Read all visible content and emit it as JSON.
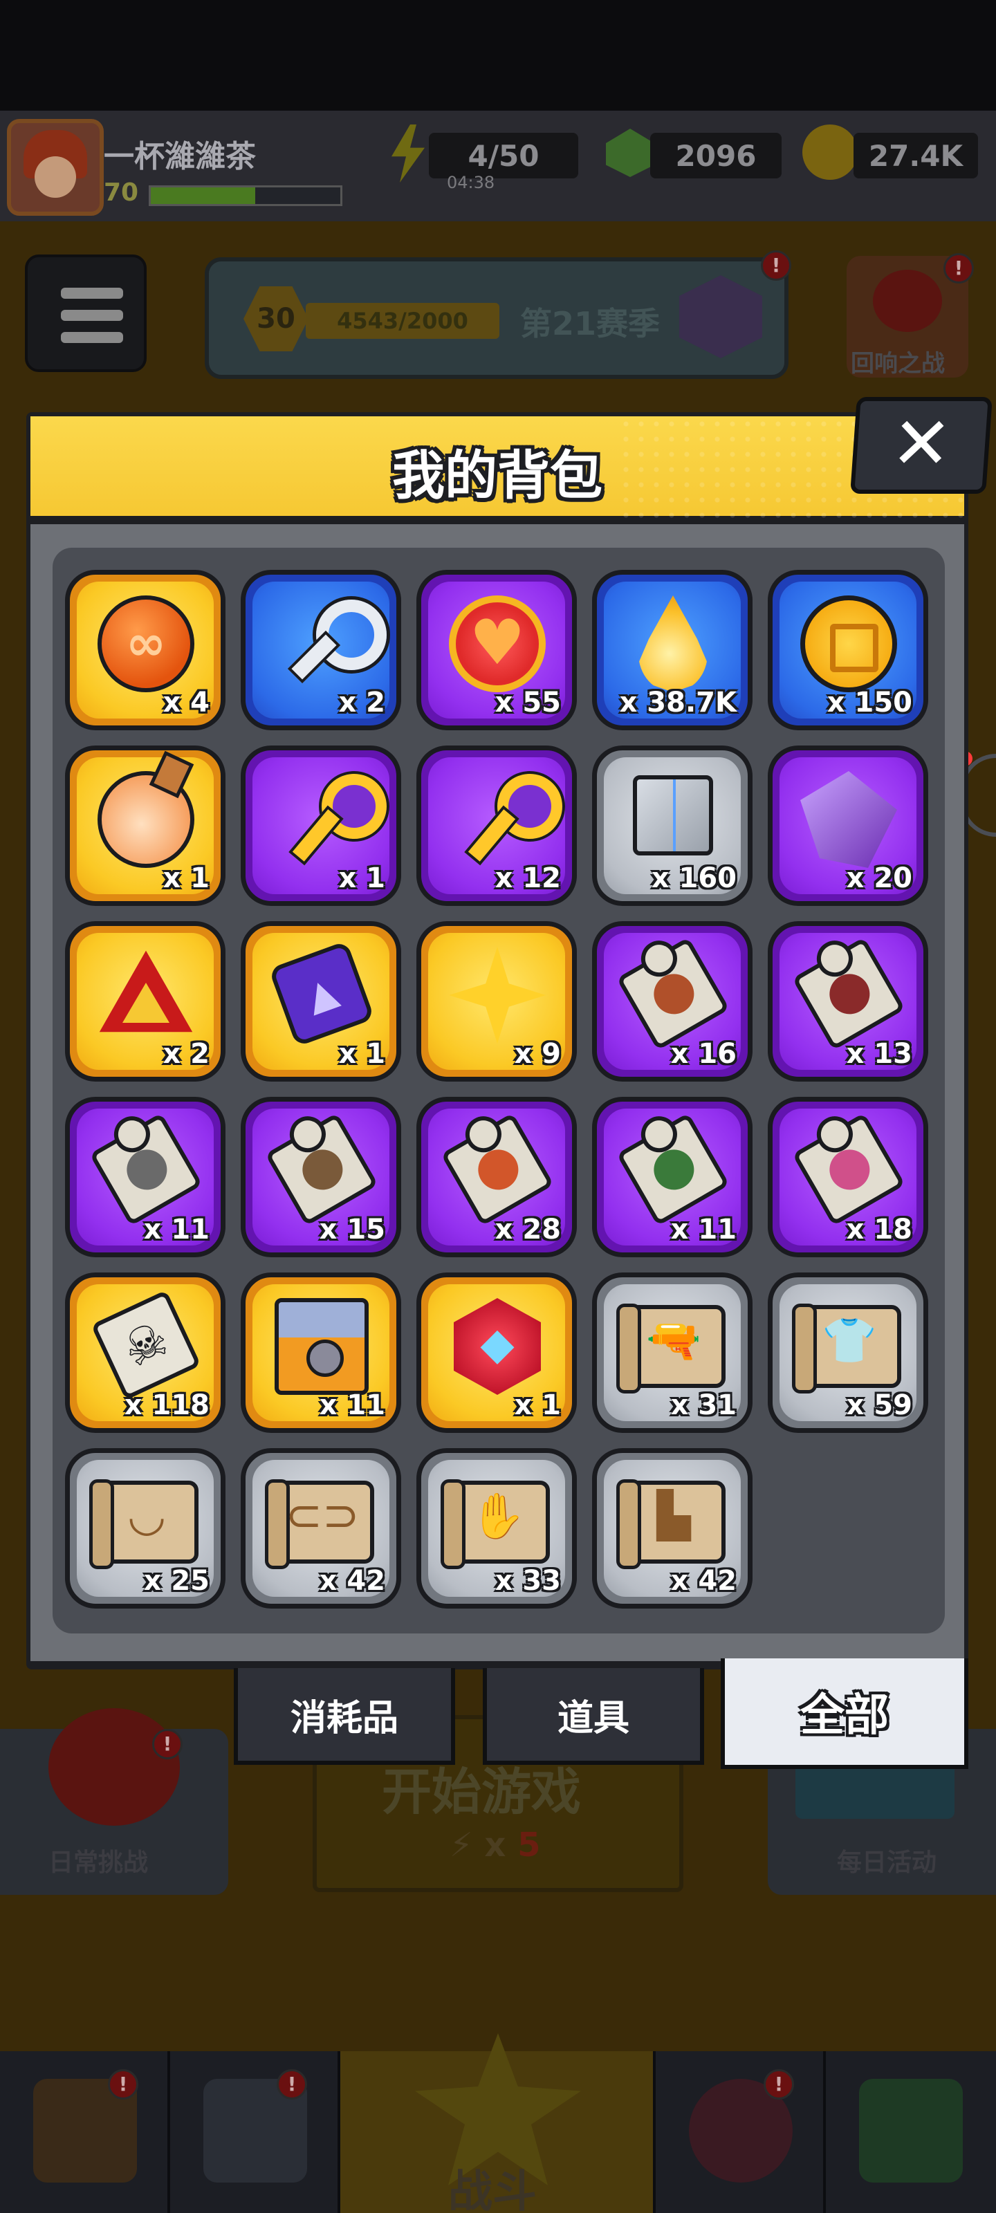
{
  "header": {
    "player_name": "一杯濰濰茶",
    "player_level": "70",
    "xp_fill": 0.55,
    "energy": "4/50",
    "energy_timer": "04:38",
    "gems": "2096",
    "coins": "27.4K"
  },
  "season": {
    "level": "30",
    "progress_text": "4543/2000",
    "season_label": "第21赛季"
  },
  "side_buttons": {
    "echo_battle": "回响之战",
    "daily_challenge": "日常挑战",
    "daily_activity": "每日活动"
  },
  "start_game": {
    "label": "开始游戏",
    "cost_prefix": "x",
    "cost": "5"
  },
  "bottom_nav": {
    "battle": "战斗"
  },
  "modal": {
    "title": "我的背包",
    "close_label": "✕",
    "tabs": [
      {
        "label": "消耗品"
      },
      {
        "label": "道具"
      },
      {
        "label": "全部",
        "active": true
      }
    ],
    "items": [
      {
        "name": "orb-item",
        "qty": "x 4",
        "rarity": "gold",
        "icon": "i-orb"
      },
      {
        "name": "silver-key-item",
        "qty": "x 2",
        "rarity": "blue",
        "icon": "i-key"
      },
      {
        "name": "heart-medal-item",
        "qty": "x 55",
        "rarity": "purple",
        "icon": "i-heart"
      },
      {
        "name": "gold-drop-item",
        "qty": "x 38.7K",
        "rarity": "blue",
        "icon": "i-drop"
      },
      {
        "name": "gold-coin-item",
        "qty": "x 150",
        "rarity": "blue",
        "icon": "i-coin"
      },
      {
        "name": "potion-item",
        "qty": "x 1",
        "rarity": "gold",
        "icon": "i-potion"
      },
      {
        "name": "gem-key-item",
        "qty": "x 1",
        "rarity": "purple",
        "icon": "i-gkey"
      },
      {
        "name": "hex-key-item",
        "qty": "x 12",
        "rarity": "purple",
        "icon": "i-gkey"
      },
      {
        "name": "metal-cube-item",
        "qty": "x 160",
        "rarity": "grey",
        "icon": "i-cube"
      },
      {
        "name": "crystal-item",
        "qty": "x 20",
        "rarity": "purple",
        "icon": "i-crystal"
      },
      {
        "name": "red-triangle-item",
        "qty": "x 2",
        "rarity": "gold",
        "icon": "i-triangle"
      },
      {
        "name": "chip-item",
        "qty": "x 1",
        "rarity": "gold",
        "icon": "i-chip"
      },
      {
        "name": "star-item",
        "qty": "x 9",
        "rarity": "gold",
        "icon": "i-star4"
      },
      {
        "name": "puzzle-item-1",
        "qty": "x 16",
        "rarity": "purple",
        "icon": "i-puzzle",
        "tint": "#b0502a"
      },
      {
        "name": "puzzle-item-2",
        "qty": "x 13",
        "rarity": "purple",
        "icon": "i-puzzle",
        "tint": "#8a2a2a"
      },
      {
        "name": "puzzle-item-3",
        "qty": "x 11",
        "rarity": "purple",
        "icon": "i-puzzle",
        "tint": "#6a6a6a"
      },
      {
        "name": "puzzle-item-4",
        "qty": "x 15",
        "rarity": "purple",
        "icon": "i-puzzle",
        "tint": "#7a5a3a"
      },
      {
        "name": "puzzle-item-5",
        "qty": "x 28",
        "rarity": "purple",
        "icon": "i-puzzle",
        "tint": "#d2562a"
      },
      {
        "name": "puzzle-item-6",
        "qty": "x 11",
        "rarity": "purple",
        "icon": "i-puzzle",
        "tint": "#3a7a3a"
      },
      {
        "name": "puzzle-item-7",
        "qty": "x 18",
        "rarity": "purple",
        "icon": "i-puzzle",
        "tint": "#d0508a"
      },
      {
        "name": "skull-puzzle-item",
        "qty": "x 118",
        "rarity": "gold",
        "icon": "i-skull"
      },
      {
        "name": "chest-item",
        "qty": "x 11",
        "rarity": "gold",
        "icon": "i-chest"
      },
      {
        "name": "d20-item",
        "qty": "x 1",
        "rarity": "gold",
        "icon": "i-d20"
      },
      {
        "name": "weapon-blueprint-item",
        "qty": "x 31",
        "rarity": "grey",
        "icon": "i-scroll",
        "glyph": "🔫"
      },
      {
        "name": "armor-blueprint-item",
        "qty": "x 59",
        "rarity": "grey",
        "icon": "i-scroll",
        "glyph": "👕"
      },
      {
        "name": "necklace-blueprint-item",
        "qty": "x 25",
        "rarity": "grey",
        "icon": "i-scroll",
        "glyph": "◡"
      },
      {
        "name": "belt-blueprint-item",
        "qty": "x 42",
        "rarity": "grey",
        "icon": "i-scroll",
        "glyph": "⊂⊃"
      },
      {
        "name": "glove-blueprint-item",
        "qty": "x 33",
        "rarity": "grey",
        "icon": "i-scroll",
        "glyph": "✋"
      },
      {
        "name": "boot-blueprint-item",
        "qty": "x 42",
        "rarity": "grey",
        "icon": "i-scroll",
        "glyph": "▙"
      }
    ]
  }
}
